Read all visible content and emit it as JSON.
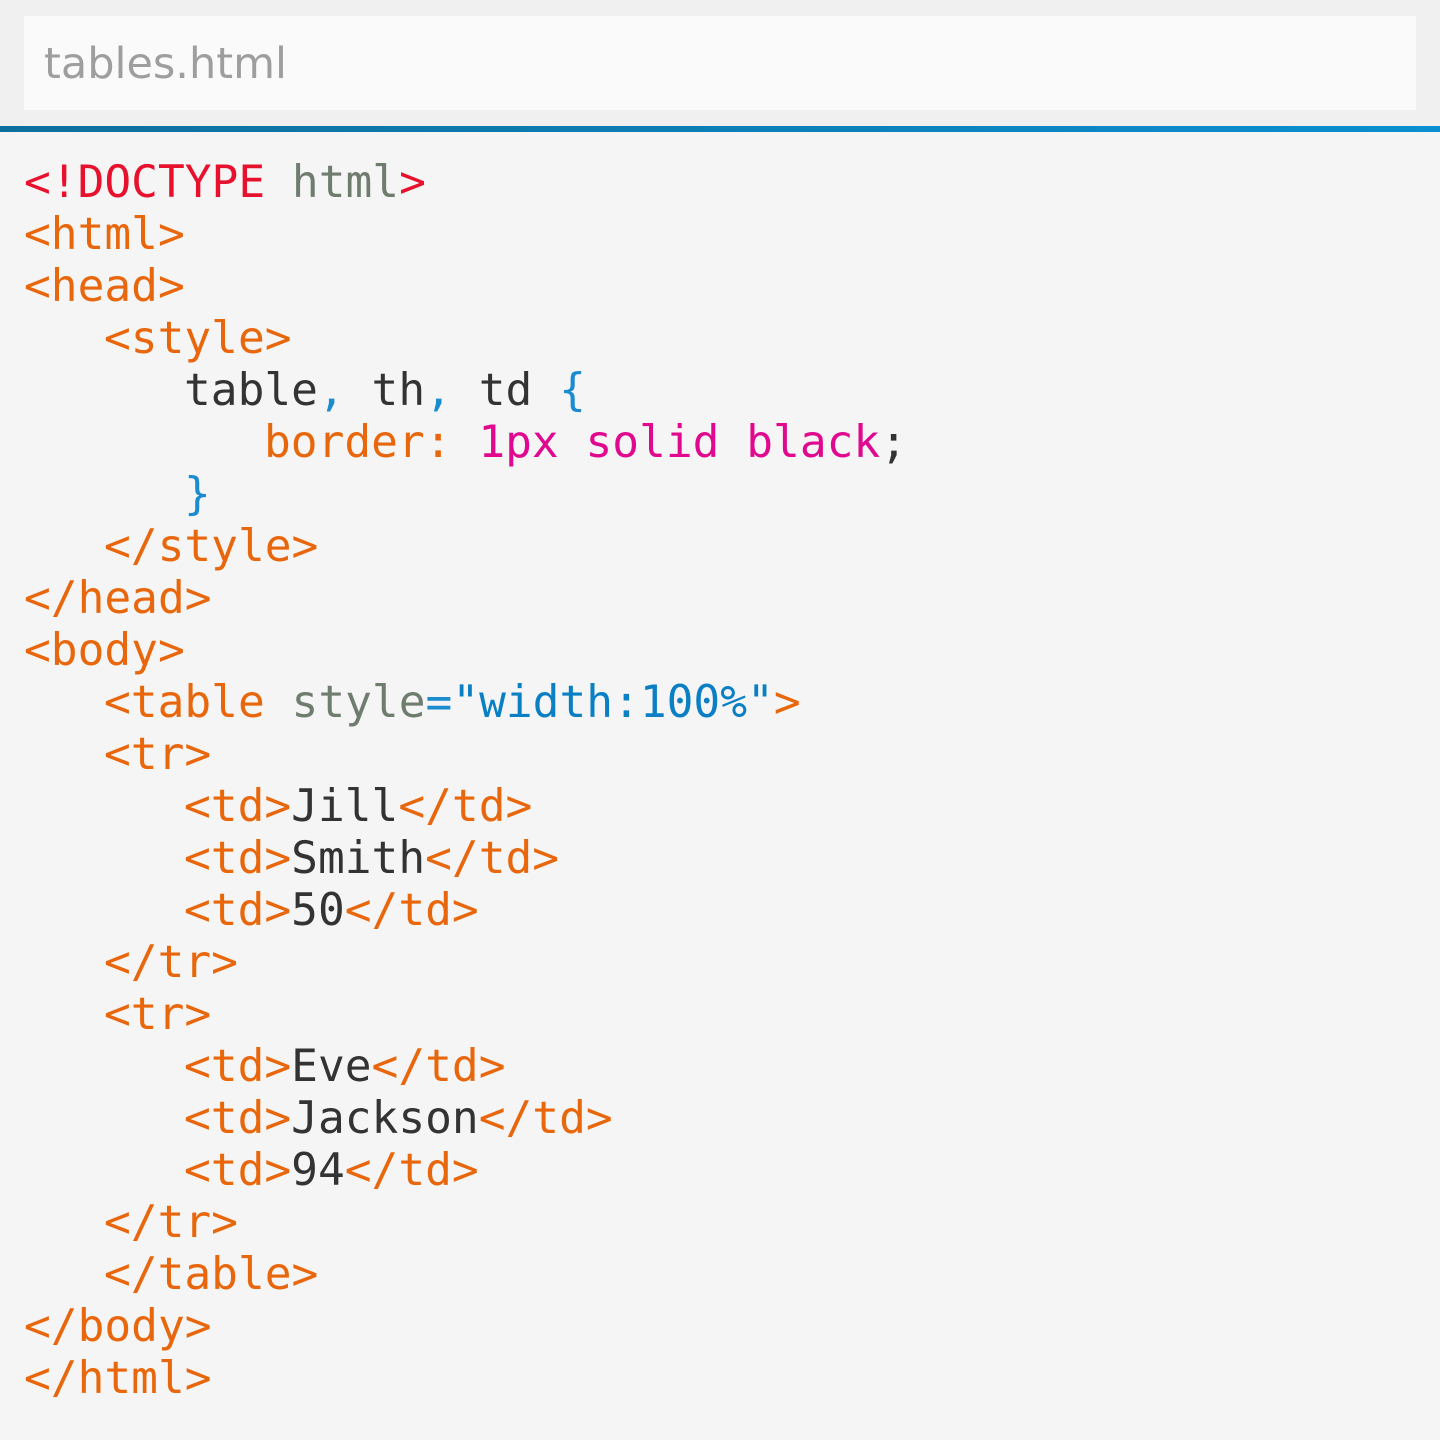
{
  "editor": {
    "file_name": "tables.html"
  },
  "colors": {
    "background": "#f5f5f5",
    "header_background": "#f0f0f0",
    "tab_background": "#fafafa",
    "file_name": "#9e9e9e",
    "accent_start": "#0e6f9c",
    "accent_end": "#0b8fd0",
    "doctype": "#e8112d",
    "tag": "#e8670c",
    "attribute": "#6f7d6f",
    "text": "#333333",
    "punctuation": "#1a8ccf",
    "string": "#0a7fc4",
    "value": "#e0088f"
  },
  "code": {
    "lines": [
      {
        "indent": 0,
        "tokens": [
          {
            "t": "<!DOCTYPE",
            "k": "doctype"
          },
          {
            "t": " ",
            "k": "text"
          },
          {
            "t": "html",
            "k": "attribute"
          },
          {
            "t": ">",
            "k": "doctype"
          }
        ]
      },
      {
        "indent": 0,
        "tokens": [
          {
            "t": "<html>",
            "k": "tag"
          }
        ]
      },
      {
        "indent": 0,
        "tokens": [
          {
            "t": "<head>",
            "k": "tag"
          }
        ]
      },
      {
        "indent": 1,
        "tokens": [
          {
            "t": "<style>",
            "k": "tag"
          }
        ]
      },
      {
        "indent": 2,
        "tokens": [
          {
            "t": "table",
            "k": "text"
          },
          {
            "t": ",",
            "k": "punctuation"
          },
          {
            "t": " th",
            "k": "text"
          },
          {
            "t": ",",
            "k": "punctuation"
          },
          {
            "t": " td ",
            "k": "text"
          },
          {
            "t": "{",
            "k": "punctuation"
          }
        ]
      },
      {
        "indent": 3,
        "tokens": [
          {
            "t": "border: ",
            "k": "tag"
          },
          {
            "t": "1px solid black",
            "k": "value"
          },
          {
            "t": ";",
            "k": "text"
          }
        ]
      },
      {
        "indent": 2,
        "tokens": [
          {
            "t": "}",
            "k": "punctuation"
          }
        ]
      },
      {
        "indent": 1,
        "tokens": [
          {
            "t": "</style>",
            "k": "tag"
          }
        ]
      },
      {
        "indent": 0,
        "tokens": [
          {
            "t": "</head>",
            "k": "tag"
          }
        ]
      },
      {
        "indent": 0,
        "tokens": [
          {
            "t": "<body>",
            "k": "tag"
          }
        ]
      },
      {
        "indent": 1,
        "tokens": [
          {
            "t": "<table",
            "k": "tag"
          },
          {
            "t": " ",
            "k": "text"
          },
          {
            "t": "style",
            "k": "attribute"
          },
          {
            "t": "=",
            "k": "punctuation"
          },
          {
            "t": "\"width:100%\"",
            "k": "string"
          },
          {
            "t": ">",
            "k": "tag"
          }
        ]
      },
      {
        "indent": 1,
        "tokens": [
          {
            "t": "<tr>",
            "k": "tag"
          }
        ]
      },
      {
        "indent": 2,
        "tokens": [
          {
            "t": "<td>",
            "k": "tag"
          },
          {
            "t": "Jill",
            "k": "text"
          },
          {
            "t": "</td>",
            "k": "tag"
          }
        ]
      },
      {
        "indent": 2,
        "tokens": [
          {
            "t": "<td>",
            "k": "tag"
          },
          {
            "t": "Smith",
            "k": "text"
          },
          {
            "t": "</td>",
            "k": "tag"
          }
        ]
      },
      {
        "indent": 2,
        "tokens": [
          {
            "t": "<td>",
            "k": "tag"
          },
          {
            "t": "50",
            "k": "text"
          },
          {
            "t": "</td>",
            "k": "tag"
          }
        ]
      },
      {
        "indent": 1,
        "tokens": [
          {
            "t": "</tr>",
            "k": "tag"
          }
        ]
      },
      {
        "indent": 1,
        "tokens": [
          {
            "t": "<tr>",
            "k": "tag"
          }
        ]
      },
      {
        "indent": 2,
        "tokens": [
          {
            "t": "<td>",
            "k": "tag"
          },
          {
            "t": "Eve",
            "k": "text"
          },
          {
            "t": "</td>",
            "k": "tag"
          }
        ]
      },
      {
        "indent": 2,
        "tokens": [
          {
            "t": "<td>",
            "k": "tag"
          },
          {
            "t": "Jackson",
            "k": "text"
          },
          {
            "t": "</td>",
            "k": "tag"
          }
        ]
      },
      {
        "indent": 2,
        "tokens": [
          {
            "t": "<td>",
            "k": "tag"
          },
          {
            "t": "94",
            "k": "text"
          },
          {
            "t": "</td>",
            "k": "tag"
          }
        ]
      },
      {
        "indent": 1,
        "tokens": [
          {
            "t": "</tr>",
            "k": "tag"
          }
        ]
      },
      {
        "indent": 1,
        "tokens": [
          {
            "t": "</table>",
            "k": "tag"
          }
        ]
      },
      {
        "indent": 0,
        "tokens": [
          {
            "t": "</body>",
            "k": "tag"
          }
        ]
      },
      {
        "indent": 0,
        "tokens": [
          {
            "t": "</html>",
            "k": "tag"
          }
        ]
      }
    ]
  }
}
